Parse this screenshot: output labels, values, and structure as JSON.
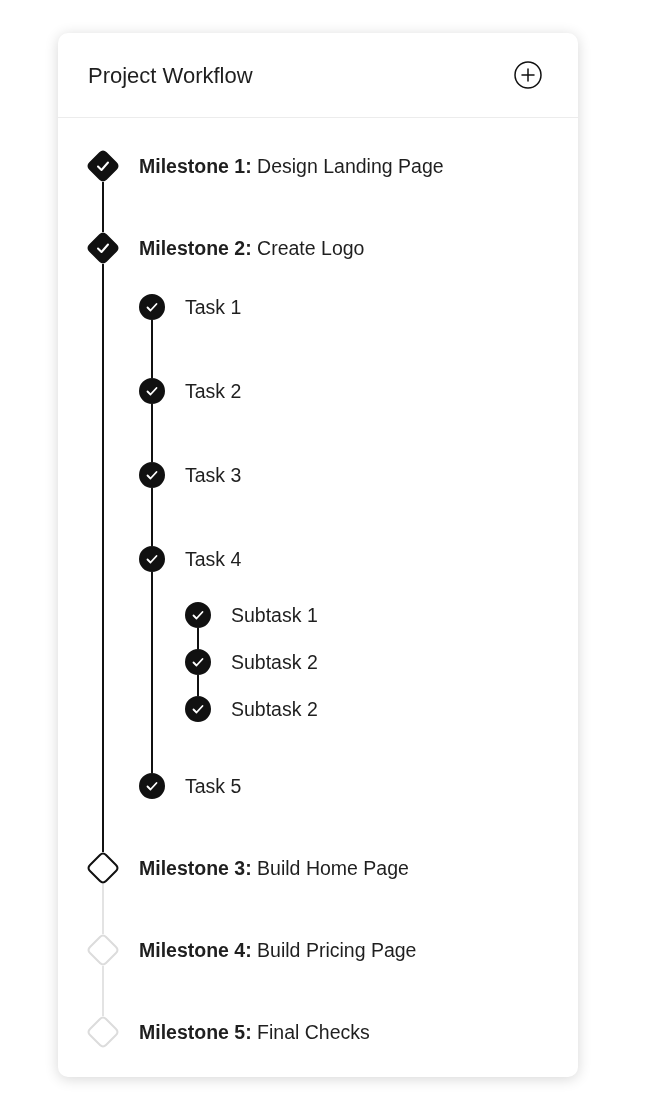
{
  "card": {
    "title": "Project Workflow"
  },
  "milestones": [
    {
      "label": "**Milestone 1:** Design Landing Page",
      "completed": true,
      "disabled": false
    },
    {
      "label": "**Milestone 2:** Create Logo",
      "completed": true,
      "disabled": false,
      "children": [
        {
          "label": "Task 1",
          "completed": true
        },
        {
          "label": "Task 2",
          "completed": true
        },
        {
          "label": "Task 3",
          "completed": true
        },
        {
          "label": "Task 4",
          "completed": true,
          "children": [
            {
              "label": "Subtask 1",
              "completed": true
            },
            {
              "label": "Subtask 2",
              "completed": true
            },
            {
              "label": "Subtask 2",
              "completed": true
            }
          ]
        },
        {
          "label": "Task 5",
          "completed": true
        }
      ]
    },
    {
      "label": "**Milestone 3:** Build Home Page",
      "completed": false,
      "disabled": false
    },
    {
      "label": "**Milestone 4:** Build Pricing Page",
      "completed": false,
      "disabled": true
    },
    {
      "label": "**Milestone 5:** Final Checks",
      "completed": false,
      "disabled": true
    }
  ]
}
